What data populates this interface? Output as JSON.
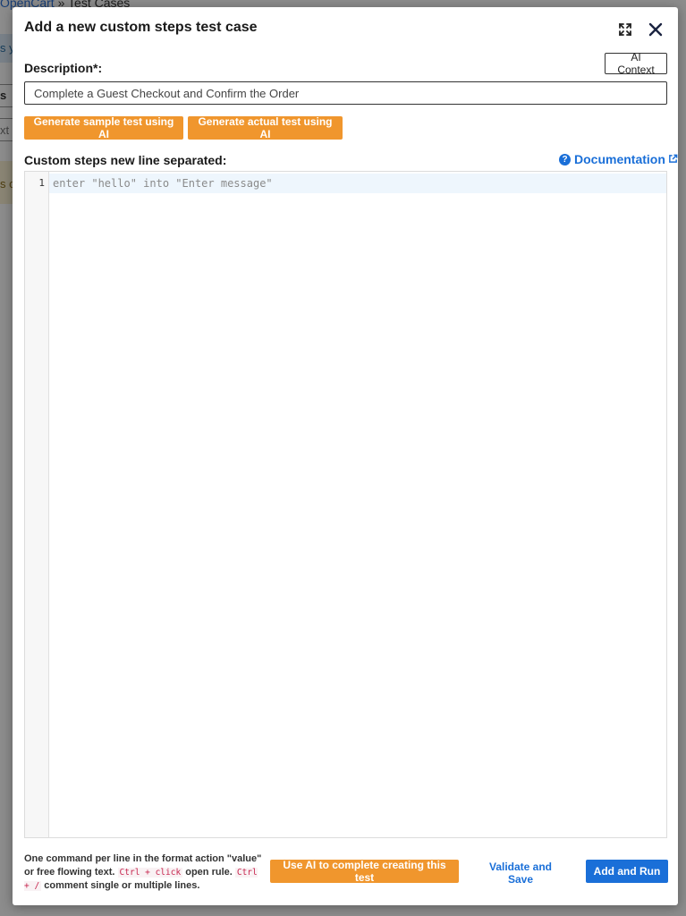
{
  "background": {
    "breadcrumb_link": "OpenCart",
    "breadcrumb_sep": "»",
    "breadcrumb_current": "Test Cases",
    "frag_1": "s y",
    "frag_2": "s",
    "frag_3": "xt",
    "frag_4": "s c"
  },
  "modal": {
    "title": "Add a new custom steps test case",
    "description_label": "Description*:",
    "ai_context_label": "AI Context",
    "description_value": "Complete a Guest Checkout and Confirm the Order",
    "generate_sample_label": "Generate sample test using AI",
    "generate_actual_label": "Generate actual test using AI",
    "steps_label": "Custom steps new line separated:",
    "documentation_label": "Documentation",
    "editor": {
      "line_number": "1",
      "placeholder": "enter \"hello\" into \"Enter message\""
    },
    "help": {
      "part1": "One command per line in the format action \"value\" or free flowing text.",
      "code1": "Ctrl + click",
      "part2": "open rule.",
      "code2": "Ctrl + /",
      "part3": "comment single or multiple lines."
    },
    "use_ai_label": "Use AI to complete creating this test",
    "validate_label": "Validate and Save",
    "add_run_label": "Add and Run"
  },
  "colors": {
    "accent_orange": "#f0962d",
    "primary_blue": "#1a6fd8"
  }
}
